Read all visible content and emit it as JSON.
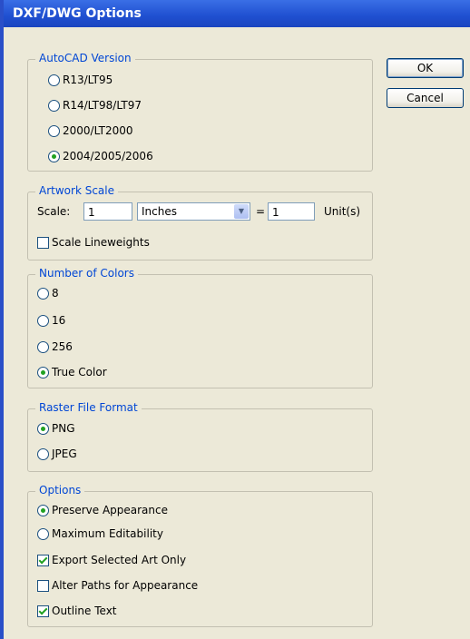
{
  "window": {
    "title": "DXF/DWG Options"
  },
  "buttons": {
    "ok": "OK",
    "cancel": "Cancel"
  },
  "autocad": {
    "legend": "AutoCAD Version",
    "options": [
      "R13/LT95",
      "R14/LT98/LT97",
      "2000/LT2000",
      "2004/2005/2006"
    ],
    "selected": "2004/2005/2006"
  },
  "artwork": {
    "legend": "Artwork Scale",
    "scale_label": "Scale:",
    "scale_value": "1",
    "unit_select": "Inches",
    "equals": "=",
    "unit_value": "1",
    "unit_label": "Unit(s)",
    "scale_lineweights": "Scale Lineweights",
    "scale_lineweights_checked": false
  },
  "colors": {
    "legend": "Number of Colors",
    "options": [
      "8",
      "16",
      "256",
      "True Color"
    ],
    "selected": "True Color"
  },
  "raster": {
    "legend": "Raster File Format",
    "options": [
      "PNG",
      "JPEG"
    ],
    "selected": "PNG"
  },
  "options": {
    "legend": "Options",
    "radios": [
      "Preserve Appearance",
      "Maximum Editability"
    ],
    "radio_selected": "Preserve Appearance",
    "checks": [
      {
        "label": "Export Selected Art Only",
        "checked": true
      },
      {
        "label": "Alter Paths for Appearance",
        "checked": false
      },
      {
        "label": "Outline Text",
        "checked": true
      }
    ]
  },
  "icons": {
    "dropdown": "chevron-down-icon"
  }
}
